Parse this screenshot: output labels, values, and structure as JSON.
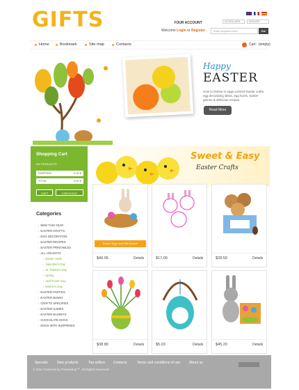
{
  "header": {
    "logo": "GIFTS",
    "your_account": "YOUR ACCOUNT",
    "welcome": "Welcome",
    "login": "Login",
    "login_sep": "or",
    "register": "Register",
    "currency_select": "US DOLLARS",
    "language_select": "ENGLISH",
    "search_placeholder": "Enter keyword here",
    "go_label": "Go!",
    "cart_label": "Cart:",
    "cart_value": "(empty)"
  },
  "nav": {
    "home": "Home",
    "bookmark": "Bookmark",
    "site_map": "Site map",
    "contacts": "Contacts"
  },
  "hero": {
    "happy": "Happy",
    "easter": "EASTER",
    "description": "How to festive to eggs-colored Easter crafts, egg decorating ideas, egg hunts, Easter games & delicious recipes.",
    "read_more": "Read More"
  },
  "cart": {
    "title": "Shopping Cart",
    "no_products": "NO PRODUCTS",
    "shipping_label": "SHIPPING",
    "shipping_value": "0.00 $",
    "total_label": "TOTAL",
    "total_value": "0.00 $",
    "cart_button": "CART",
    "checkout_button": "CHECKOUT"
  },
  "banner": {
    "line1": "Sweet & Easy",
    "line2": "Easter Crafts"
  },
  "categories": {
    "title": "Categories",
    "items": [
      "NEW THIS YEAR",
      "EASTER CRAFTS",
      "EGG DECORATION",
      "EASTER RECIPES",
      "EASTER PRINTABLES",
      "ALL HOLIDAYS",
      "Easter crafts",
      "Valentine's Day",
      "St. Patrick's Day",
      "Spring",
      "April Fools' Day",
      "Mother's Day",
      "EASTER PARTIES",
      "EASTER BUNNY",
      "CRAFTS SPECIFIES",
      "EASTER GAMES",
      "EASTER BASKETS",
      "CHOCOLATE EGGS",
      "EGGS WITH SURPRISES"
    ]
  },
  "products": [
    {
      "price": "$49.95",
      "details": "Details",
      "add_to_cart": "Easter Egg Hunt Gift Basket"
    },
    {
      "price": "$17.00",
      "details": "Details"
    },
    {
      "price": "$28.50",
      "details": "Details"
    },
    {
      "price": "$38.80",
      "details": "Details"
    },
    {
      "price": "$5.03",
      "details": "Details"
    },
    {
      "price": "$45.20",
      "details": "Details"
    }
  ],
  "footer": {
    "specials": "Specials",
    "new_products": "New products",
    "top_sellers": "Top sellers",
    "contacts": "Contacts",
    "terms": "Terms and conditions of use",
    "about": "About us",
    "copyright": "© 2011 Powered by Prestashop™. All Rights Reserved"
  },
  "colors": {
    "logo": "#f4b318",
    "green": "#7cb82f",
    "orange": "#f6a11a",
    "footer": "#a9a9a9"
  }
}
